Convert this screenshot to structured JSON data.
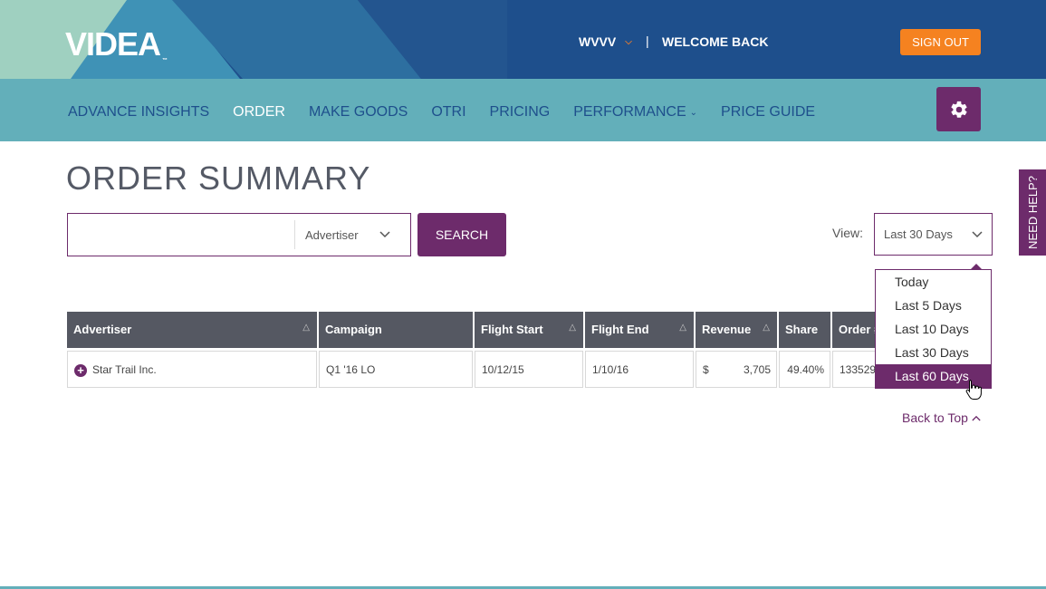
{
  "header": {
    "logo": "VIDEA",
    "logo_tm": "™",
    "station": "WVVV",
    "separator": "|",
    "welcome": "WELCOME BACK",
    "signout_label": "SIGN OUT"
  },
  "nav": {
    "items": [
      {
        "label": "ADVANCE INSIGHTS"
      },
      {
        "label": "ORDER"
      },
      {
        "label": "MAKE GOODS"
      },
      {
        "label": "OTRI"
      },
      {
        "label": "PRICING"
      },
      {
        "label": "PERFORMANCE"
      },
      {
        "label": "PRICE GUIDE"
      }
    ],
    "active": "ORDER",
    "settings_icon": "gear-icon"
  },
  "page": {
    "title": "ORDER SUMMARY"
  },
  "search": {
    "value": "",
    "filter_value": "Advertiser",
    "button_label": "SEARCH"
  },
  "view": {
    "label": "View:",
    "selected": "Last 30 Days",
    "options": [
      "Today",
      "Last 5 Days",
      "Last 10 Days",
      "Last 30 Days",
      "Last 60 Days"
    ],
    "highlighted": "Last 60 Days"
  },
  "table": {
    "columns": [
      "Advertiser",
      "Campaign",
      "Flight Start",
      "Flight End",
      "Revenue",
      "Share",
      "Order #"
    ],
    "rows": [
      {
        "advertiser": "Star Trail Inc.",
        "campaign": "Q1 '16 LO",
        "flight_start": "10/12/15",
        "flight_end": "1/10/16",
        "revenue_currency": "$",
        "revenue": "3,705",
        "share": "49.40%",
        "order": "133529"
      }
    ]
  },
  "footer": {
    "back_to_top": "Back to Top"
  },
  "help": {
    "label": "NEED HELP?"
  },
  "colors": {
    "brand_purple": "#6d2b6b",
    "nav_teal": "#63afba",
    "header_blue": "#1e4f8c",
    "signout_orange": "#f58220",
    "table_header": "#555862"
  }
}
